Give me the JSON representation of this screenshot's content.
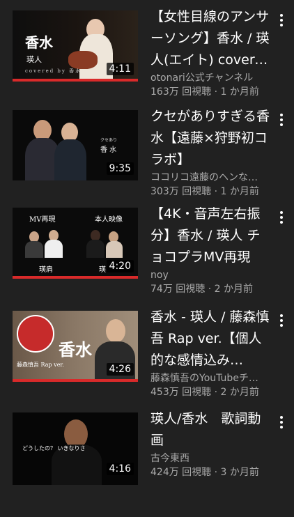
{
  "videos": [
    {
      "title": "【女性目線のアンサーソング】香水 / 瑛人(エイト) covered by",
      "channel": "otonari公式チャンネル",
      "views": "163万 回視聴",
      "age": "1 か月前",
      "duration": "4:11",
      "thumb_title": "香水",
      "thumb_sub": "瑛人",
      "thumb_caption": "covered by 香水"
    },
    {
      "title": "クセがありすぎる香水【遠藤×狩野初コラボ】",
      "channel": "ココリコ遠藤のヘンな…",
      "views": "303万 回視聴",
      "age": "1 か月前",
      "duration": "9:35",
      "thumb_small": "クセあり",
      "thumb_title": "香 水"
    },
    {
      "title": "【4K・音声左右振分】香水 / 瑛人 チョコプラMV再現",
      "channel": "noy",
      "views": "74万 回視聴",
      "age": "2 か月前",
      "duration": "4:20",
      "thumb_left": "MV再現",
      "thumb_right": "本人映像",
      "thumb_bottom_left": "瑛肩",
      "thumb_bottom_right": "瑛"
    },
    {
      "title": "香水 - 瑛人 / 藤森慎吾 Rap ver.【個人的な感情込み…",
      "channel": "藤森慎吾のYouTubeチ…",
      "views": "453万 回視聴",
      "age": "2 か月前",
      "duration": "4:26",
      "thumb_title": "香水",
      "thumb_sub": "藤森慎吾 Rap ver."
    },
    {
      "title": "瑛人/香水　歌詞動画",
      "channel": "古今東西",
      "views": "424万 回視聴",
      "age": "3 か月前",
      "duration": "4:16",
      "thumb_caption": "どうしたの？ いきなりさ"
    }
  ],
  "separator": " · ",
  "colors": {
    "background": "#212121",
    "progress": "#d92a2a",
    "secondary_text": "#aaaaaa"
  },
  "icons": {
    "more": "kebab-menu-icon"
  }
}
